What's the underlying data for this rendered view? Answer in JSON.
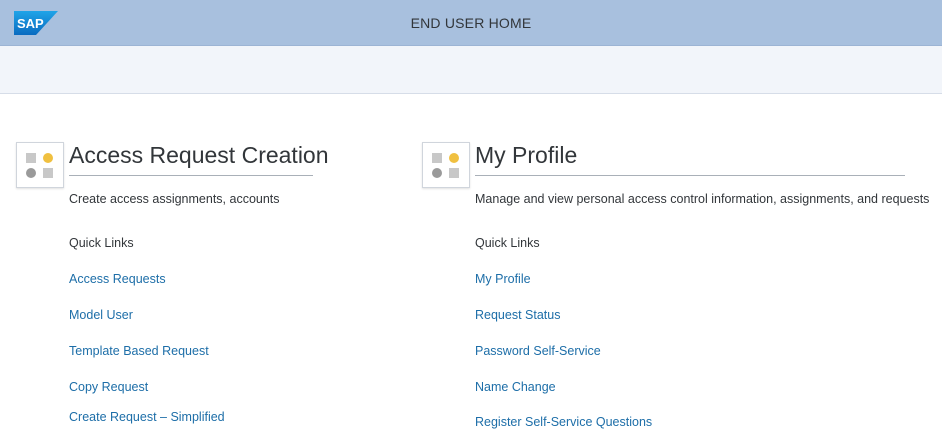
{
  "shell": {
    "logo_text": "SAP",
    "title": "END USER HOME"
  },
  "cards": [
    {
      "title": "Access Request Creation",
      "description": "Create access assignments, accounts",
      "quick_links_label": "Quick Links",
      "links": [
        "Access Requests",
        "Model User",
        "Template Based Request",
        "Copy Request",
        "Create Request – Simplified"
      ]
    },
    {
      "title": "My Profile",
      "description": "Manage and view personal access control information, assignments, and requests",
      "quick_links_label": "Quick Links",
      "links": [
        "My Profile",
        "Request Status",
        "Password Self-Service",
        "Name Change",
        "Register Self-Service Questions"
      ]
    }
  ],
  "colors": {
    "shell_bar": "#a8c0de",
    "link": "#1d6ea8",
    "icon_yellow": "#f0c040",
    "icon_gray": "#9a9a9a"
  },
  "icons": {
    "logo": "sap-logo-icon",
    "tile": "tile-grid-icon"
  }
}
